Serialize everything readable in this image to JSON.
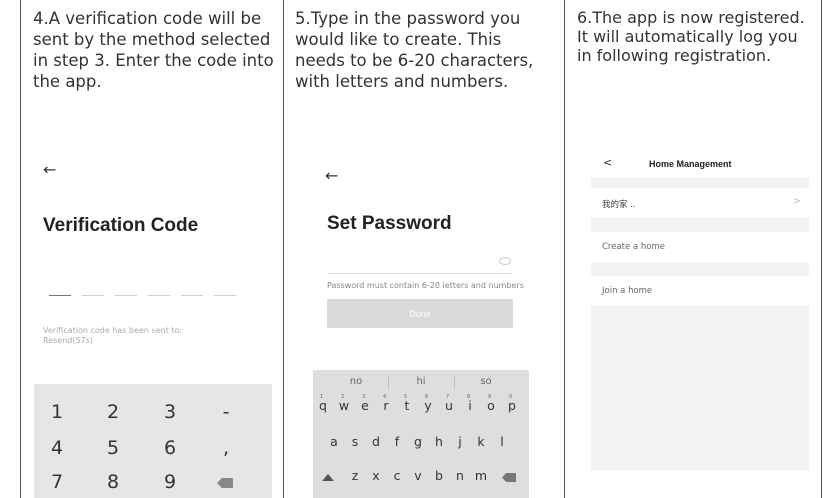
{
  "panel1": {
    "instruction": "4.A verification code will be sent by the method selected in step 3. Enter the code into the app.",
    "back_arrow": "←",
    "title": "Verification Code",
    "sent_text": "Verification code has been sent to:",
    "resend": "Resend(57s)",
    "keypad": [
      "1",
      "2",
      "3",
      "-",
      "4",
      "5",
      "6",
      ",",
      "7",
      "8",
      "9"
    ]
  },
  "panel2": {
    "instruction": "5.Type in the password you would like to create. This needs to be 6-20 characters, with letters and numbers.",
    "back_arrow": "←",
    "title": "Set Password",
    "hint": "Password must contain 6-20 letters and numbers",
    "done_label": "Done",
    "suggestions": [
      "no",
      "hi",
      "so"
    ],
    "row1": [
      "q",
      "w",
      "e",
      "r",
      "t",
      "y",
      "u",
      "i",
      "o",
      "p"
    ],
    "row1_nums": [
      "1",
      "2",
      "3",
      "4",
      "5",
      "6",
      "7",
      "8",
      "9",
      "0"
    ],
    "row2": [
      "a",
      "s",
      "d",
      "f",
      "g",
      "h",
      "j",
      "k",
      "l"
    ],
    "row3": [
      "z",
      "x",
      "c",
      "v",
      "b",
      "n",
      "m"
    ]
  },
  "panel3": {
    "instruction": "6.The app is now registered. It will automatically log you in following registration.",
    "back": "<",
    "title": "Home Management",
    "home_name": "我的家 ..",
    "create_home": "Create a home",
    "join_home": "Join a home",
    "chevron": ">"
  }
}
